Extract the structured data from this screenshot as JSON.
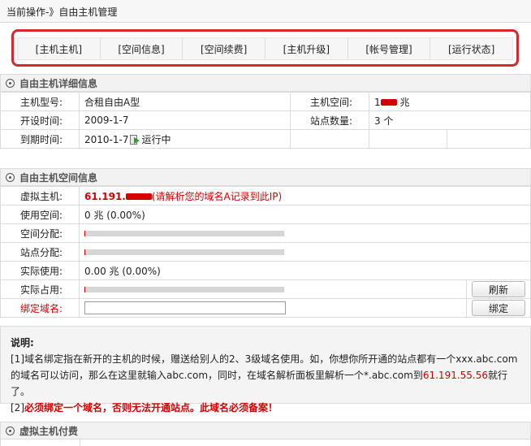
{
  "breadcrumb": "当前操作-》自由主机管理",
  "tabs": [
    {
      "label": "[主机主机]"
    },
    {
      "label": "[空间信息]"
    },
    {
      "label": "[空间续费]"
    },
    {
      "label": "[主机升级]"
    },
    {
      "label": "[帐号管理]"
    },
    {
      "label": "[运行状态]"
    }
  ],
  "host_detail": {
    "title": "自由主机详细信息",
    "model_label": "主机型号:",
    "model_value": "合租自由A型",
    "space_label": "主机空间:",
    "space_value_prefix": "1",
    "space_value_suffix": "兆",
    "open_label": "开设时间:",
    "open_value": "2009-1-7",
    "sites_label": "站点数量:",
    "sites_value": "3 个",
    "expire_label": "到期时间:",
    "expire_value": "2010-1-7",
    "status_value": "运行中"
  },
  "space_info": {
    "title": "自由主机空间信息",
    "vhost_label": "虚拟主机:",
    "vhost_ip_prefix": "61.191.",
    "vhost_hint": "(请解析您的域名A记录到此IP)",
    "used_label": "使用空间:",
    "used_value": "0 兆  (0.00%)",
    "space_alloc_label": "空间分配:",
    "space_alloc_pct": 0.5,
    "site_alloc_label": "站点分配:",
    "site_alloc_pct": 0.5,
    "actual_use_label": "实际使用:",
    "actual_use_value": "0.00 兆  (0.00%)",
    "actual_occ_label": "实际占用:",
    "actual_occ_pct": 0.5,
    "refresh_label": "刷新",
    "bind_label": "绑定域名:",
    "bind_value": "",
    "bind_button": "绑定"
  },
  "note": {
    "title": "说明:",
    "line1": "[1]域名绑定指在新开的主机的时候，赠送给别人的2、3级域名使用。如，你想你所开通的站点都有一个xxx.abc.com的域名可以访问，那么在这里就输入abc.com，同时，在域名解析面板里解析一个*.abc.com到",
    "line1_ip": "61.191.55.56",
    "line1_end": "就行了。",
    "line2_prefix": "[2]",
    "line2_bold": "必须绑定一个域名，否则无法开通站点。此域名必须备案！"
  },
  "payment": {
    "title": "虚拟主机付费"
  },
  "colors": {
    "accent_red": "#d40000",
    "tab_border_red": "#d32b2b"
  }
}
